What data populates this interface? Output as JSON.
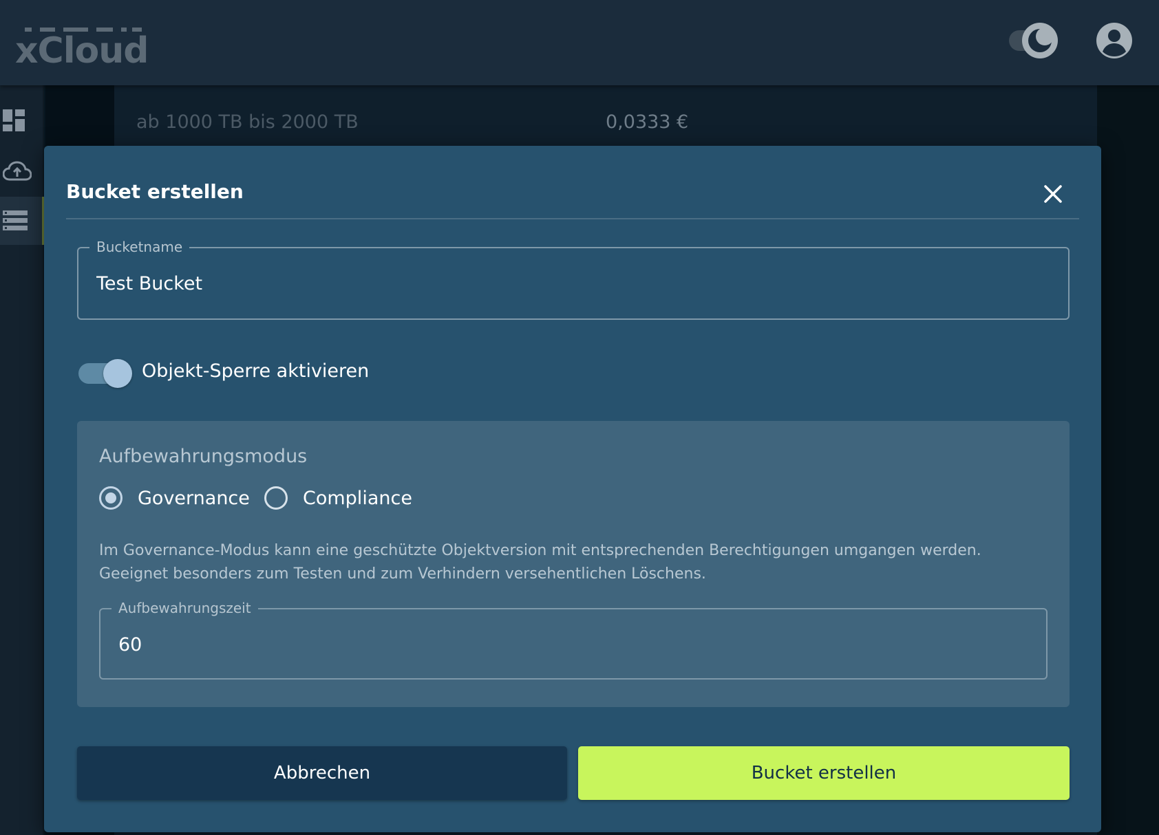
{
  "header": {
    "logo_text": "xCloud",
    "theme_toggle_icon": "moon-icon",
    "account_icon": "account-circle-icon"
  },
  "sidebar": {
    "items": [
      {
        "icon": "dashboard-icon",
        "active": false
      },
      {
        "icon": "cloud-upload-icon",
        "active": false
      },
      {
        "icon": "storage-list-icon",
        "active": true
      }
    ]
  },
  "background_table": {
    "row_label": "ab 1000 TB bis 2000 TB",
    "row_value": "0,0333 €"
  },
  "modal": {
    "title": "Bucket erstellen",
    "close_icon": "close-icon",
    "bucket_name": {
      "label": "Bucketname",
      "value": "Test Bucket"
    },
    "object_lock": {
      "label": "Objekt-Sperre aktivieren",
      "enabled": true
    },
    "retention": {
      "title": "Aufbewahrungsmodus",
      "options": [
        {
          "label": "Governance",
          "selected": true
        },
        {
          "label": "Compliance",
          "selected": false
        }
      ],
      "description_line1": "Im Governance-Modus kann eine geschützte Objektversion mit entsprechenden Berechtigungen umgangen werden.",
      "description_line2": "Geeignet besonders zum Testen und zum Verhindern versehentlichen Löschens.",
      "time_field": {
        "label": "Aufbewahrungszeit",
        "value": "60"
      }
    },
    "buttons": {
      "cancel_label": "Abbrechen",
      "create_label": "Bucket erstellen"
    }
  },
  "colors": {
    "modal_bg": "#27526e",
    "panel_bg": "#40657d",
    "accent_green": "#c8f55c",
    "cancel_bg": "#163650",
    "topbar_bg": "#1b2c3c"
  }
}
